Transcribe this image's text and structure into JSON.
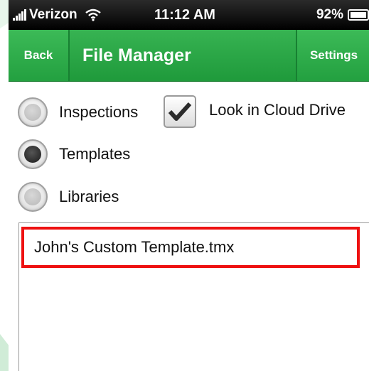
{
  "status_bar": {
    "carrier": "Verizon",
    "time": "11:12 AM",
    "battery": "92%",
    "icons": [
      "signal-bars-icon",
      "wifi-icon",
      "battery-icon"
    ]
  },
  "nav": {
    "back_label": "Back",
    "title": "File Manager",
    "settings_label": "Settings"
  },
  "options": [
    {
      "label": "Inspections",
      "selected": false
    },
    {
      "label": "Templates",
      "selected": true
    },
    {
      "label": "Libraries",
      "selected": false
    }
  ],
  "cloud_checkbox": {
    "label": "Look in Cloud Drive",
    "checked": true
  },
  "files": [
    {
      "name": "John's Custom Template.tmx",
      "highlighted": true
    }
  ],
  "colors": {
    "nav_green": "#2aa846",
    "highlight_red": "#ee1111",
    "status_black": "#000000"
  }
}
